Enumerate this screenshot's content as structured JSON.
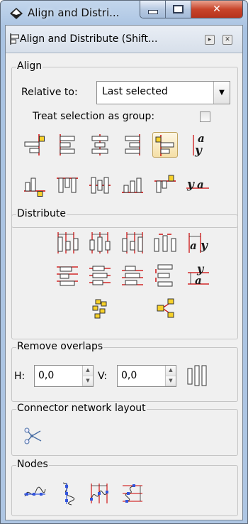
{
  "window": {
    "title": "Align and Distri...",
    "icon": "inkscape-icon",
    "controls": {
      "minimize": "minimize-icon",
      "maximize": "maximize-icon",
      "close": "✕"
    }
  },
  "dock": {
    "title": "Align and Distribute (Shift...",
    "icon": "align-distribute-icon",
    "buttons": [
      "iconify-icon",
      "close-panel-icon"
    ]
  },
  "align": {
    "section_label": "Align",
    "relative_to_label": "Relative to:",
    "relative_to_value": "Last selected",
    "treat_as_group_label": "Treat selection as group:",
    "treat_as_group_checked": false,
    "row1": [
      "align-right-edges-to-left-anchor",
      "align-left-edges",
      "center-on-vertical-axis",
      "align-right-edges",
      "align-left-edges-to-right-anchor",
      "align-baseline-text-vertically"
    ],
    "row2": [
      "align-bottom-edges-to-top-anchor",
      "align-top-edges",
      "center-on-horizontal-axis",
      "align-bottom-edges",
      "align-top-edges-to-bottom-anchor",
      "align-baseline-text-horizontally"
    ],
    "pressed_index": 4,
    "text_glyph_a": "a",
    "text_glyph_y": "y"
  },
  "distribute": {
    "section_label": "Distribute",
    "row1": [
      "distribute-left-edges",
      "distribute-centers-horizontally",
      "distribute-right-edges",
      "distribute-gaps-horizontally",
      "distribute-baselines-horizontally"
    ],
    "row2": [
      "distribute-top-edges",
      "distribute-centers-vertically",
      "distribute-bottom-edges",
      "distribute-gaps-vertically",
      "distribute-baselines-vertically"
    ],
    "row3": [
      "randomize-positions",
      "unclump"
    ]
  },
  "remove_overlaps": {
    "section_label": "Remove overlaps",
    "h_label": "H:",
    "h_value": "0,0",
    "v_label": "V:",
    "v_value": "0,0",
    "apply_icon": "remove-overlaps-icon"
  },
  "connector": {
    "section_label": "Connector network layout",
    "icon": "graph-layout-icon"
  },
  "nodes": {
    "section_label": "Nodes",
    "buttons": [
      "align-nodes-horizontally",
      "align-nodes-vertically",
      "distribute-nodes-horizontally",
      "distribute-nodes-vertically"
    ]
  },
  "colors": {
    "accent_red": "#d00000",
    "yellow": "#f7d12a",
    "blue_node": "#3355dd"
  }
}
